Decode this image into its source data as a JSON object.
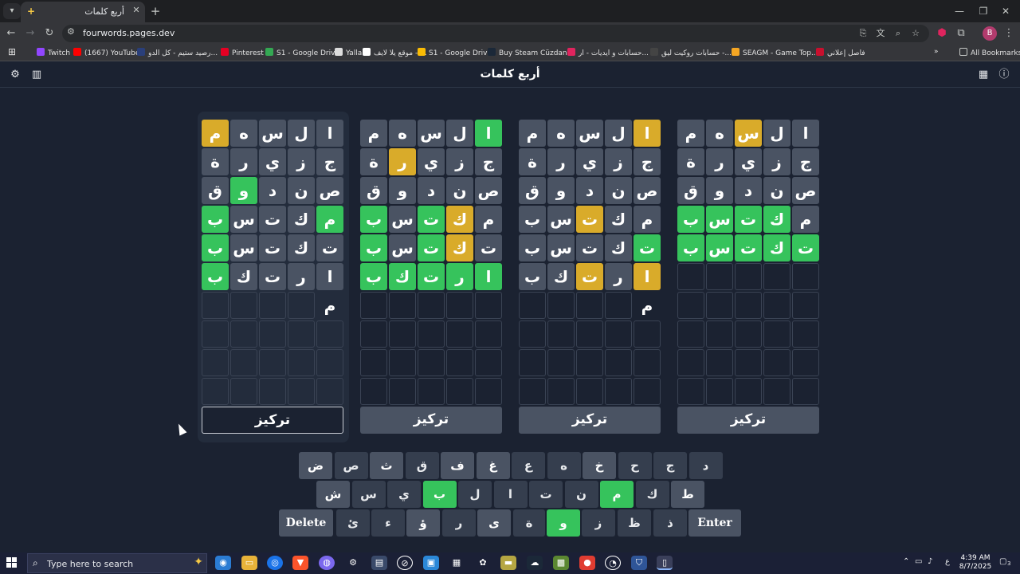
{
  "browser": {
    "tab_title": "أربع كلمات",
    "tab_favicon": "+",
    "tab_close": "✕",
    "new_tab": "+",
    "tab_menu": "▾",
    "window_controls": {
      "minimize": "—",
      "restore": "❐",
      "close": "✕"
    },
    "url": "fourwords.pages.dev",
    "profile_initial": "B"
  },
  "bookmarks": {
    "items": [
      {
        "label": "Twitch",
        "color": "#9146ff"
      },
      {
        "label": "(1667) YouTube",
        "color": "#ff0000"
      },
      {
        "label": "رصيد ستيم - كل الدو...",
        "color": "#2a3f7a"
      },
      {
        "label": "Pinterest",
        "color": "#e60023"
      },
      {
        "label": "S1 - Google Drive",
        "color": "#34a853"
      },
      {
        "label": "Yalla",
        "color": "#dddddd"
      },
      {
        "label": "موقع يلا لايف - ...",
        "color": "#ffffff"
      },
      {
        "label": "S1 - Google Drive",
        "color": "#fbbc04"
      },
      {
        "label": "Buy Steam Cüzdan...",
        "color": "#1b2838"
      },
      {
        "label": "حسابات و ايديات - ار...",
        "color": "#e0245e"
      },
      {
        "label": "حسابات روكيت ليق -...",
        "color": "#444444"
      },
      {
        "label": "SEAGM - Game Top...",
        "color": "#f5a623"
      },
      {
        "label": "فاصل إعلاني",
        "color": "#c8102e"
      }
    ],
    "more": "»",
    "all_bookmarks": "All Bookmarks"
  },
  "app": {
    "title": "أربع كلمات",
    "focus_label": "تركيز"
  },
  "boards": [
    {
      "rows": [
        [
          {
            "l": "م",
            "s": "y"
          },
          {
            "l": "ه",
            "s": "a"
          },
          {
            "l": "س",
            "s": "a"
          },
          {
            "l": "ل",
            "s": "a"
          },
          {
            "l": "ا",
            "s": "a"
          }
        ],
        [
          {
            "l": "ة",
            "s": "a"
          },
          {
            "l": "ر",
            "s": "a"
          },
          {
            "l": "ي",
            "s": "a"
          },
          {
            "l": "ز",
            "s": "a"
          },
          {
            "l": "ج",
            "s": "a"
          }
        ],
        [
          {
            "l": "ق",
            "s": "a"
          },
          {
            "l": "و",
            "s": "g"
          },
          {
            "l": "د",
            "s": "a"
          },
          {
            "l": "ن",
            "s": "a"
          },
          {
            "l": "ص",
            "s": "a"
          }
        ],
        [
          {
            "l": "ب",
            "s": "g"
          },
          {
            "l": "س",
            "s": "a"
          },
          {
            "l": "ت",
            "s": "a"
          },
          {
            "l": "ك",
            "s": "a"
          },
          {
            "l": "م",
            "s": "g"
          }
        ],
        [
          {
            "l": "ب",
            "s": "g"
          },
          {
            "l": "س",
            "s": "a"
          },
          {
            "l": "ت",
            "s": "a"
          },
          {
            "l": "ك",
            "s": "a"
          },
          {
            "l": "ت",
            "s": "a"
          }
        ],
        [
          {
            "l": "ب",
            "s": "g"
          },
          {
            "l": "ك",
            "s": "a"
          },
          {
            "l": "ت",
            "s": "a"
          },
          {
            "l": "ر",
            "s": "a"
          },
          {
            "l": "ا",
            "s": "a"
          }
        ],
        [
          {
            "l": "",
            "s": "e"
          },
          {
            "l": "",
            "s": "e"
          },
          {
            "l": "",
            "s": "e"
          },
          {
            "l": "",
            "s": "e"
          },
          {
            "l": "م",
            "s": "t"
          }
        ],
        [
          {
            "l": "",
            "s": "e"
          },
          {
            "l": "",
            "s": "e"
          },
          {
            "l": "",
            "s": "e"
          },
          {
            "l": "",
            "s": "e"
          },
          {
            "l": "",
            "s": "e"
          }
        ],
        [
          {
            "l": "",
            "s": "e"
          },
          {
            "l": "",
            "s": "e"
          },
          {
            "l": "",
            "s": "e"
          },
          {
            "l": "",
            "s": "e"
          },
          {
            "l": "",
            "s": "e"
          }
        ],
        [
          {
            "l": "",
            "s": "e"
          },
          {
            "l": "",
            "s": "e"
          },
          {
            "l": "",
            "s": "e"
          },
          {
            "l": "",
            "s": "e"
          },
          {
            "l": "",
            "s": "e"
          }
        ]
      ]
    },
    {
      "rows": [
        [
          {
            "l": "م",
            "s": "a"
          },
          {
            "l": "ه",
            "s": "a"
          },
          {
            "l": "س",
            "s": "a"
          },
          {
            "l": "ل",
            "s": "a"
          },
          {
            "l": "ا",
            "s": "g"
          }
        ],
        [
          {
            "l": "ة",
            "s": "a"
          },
          {
            "l": "ر",
            "s": "y"
          },
          {
            "l": "ي",
            "s": "a"
          },
          {
            "l": "ز",
            "s": "a"
          },
          {
            "l": "ج",
            "s": "a"
          }
        ],
        [
          {
            "l": "ق",
            "s": "a"
          },
          {
            "l": "و",
            "s": "a"
          },
          {
            "l": "د",
            "s": "a"
          },
          {
            "l": "ن",
            "s": "a"
          },
          {
            "l": "ص",
            "s": "a"
          }
        ],
        [
          {
            "l": "ب",
            "s": "g"
          },
          {
            "l": "س",
            "s": "a"
          },
          {
            "l": "ت",
            "s": "g"
          },
          {
            "l": "ك",
            "s": "y"
          },
          {
            "l": "م",
            "s": "a"
          }
        ],
        [
          {
            "l": "ب",
            "s": "g"
          },
          {
            "l": "س",
            "s": "a"
          },
          {
            "l": "ت",
            "s": "g"
          },
          {
            "l": "ك",
            "s": "y"
          },
          {
            "l": "ت",
            "s": "a"
          }
        ],
        [
          {
            "l": "ب",
            "s": "g"
          },
          {
            "l": "ك",
            "s": "g"
          },
          {
            "l": "ت",
            "s": "g"
          },
          {
            "l": "ر",
            "s": "g"
          },
          {
            "l": "ا",
            "s": "g"
          }
        ],
        [
          {
            "l": "",
            "s": "e"
          },
          {
            "l": "",
            "s": "e"
          },
          {
            "l": "",
            "s": "e"
          },
          {
            "l": "",
            "s": "e"
          },
          {
            "l": "",
            "s": "e"
          }
        ],
        [
          {
            "l": "",
            "s": "e"
          },
          {
            "l": "",
            "s": "e"
          },
          {
            "l": "",
            "s": "e"
          },
          {
            "l": "",
            "s": "e"
          },
          {
            "l": "",
            "s": "e"
          }
        ],
        [
          {
            "l": "",
            "s": "e"
          },
          {
            "l": "",
            "s": "e"
          },
          {
            "l": "",
            "s": "e"
          },
          {
            "l": "",
            "s": "e"
          },
          {
            "l": "",
            "s": "e"
          }
        ],
        [
          {
            "l": "",
            "s": "e"
          },
          {
            "l": "",
            "s": "e"
          },
          {
            "l": "",
            "s": "e"
          },
          {
            "l": "",
            "s": "e"
          },
          {
            "l": "",
            "s": "e"
          }
        ]
      ]
    },
    {
      "rows": [
        [
          {
            "l": "م",
            "s": "a"
          },
          {
            "l": "ه",
            "s": "a"
          },
          {
            "l": "س",
            "s": "a"
          },
          {
            "l": "ل",
            "s": "a"
          },
          {
            "l": "ا",
            "s": "y"
          }
        ],
        [
          {
            "l": "ة",
            "s": "a"
          },
          {
            "l": "ر",
            "s": "a"
          },
          {
            "l": "ي",
            "s": "a"
          },
          {
            "l": "ز",
            "s": "a"
          },
          {
            "l": "ج",
            "s": "a"
          }
        ],
        [
          {
            "l": "ق",
            "s": "a"
          },
          {
            "l": "و",
            "s": "a"
          },
          {
            "l": "د",
            "s": "a"
          },
          {
            "l": "ن",
            "s": "a"
          },
          {
            "l": "ص",
            "s": "a"
          }
        ],
        [
          {
            "l": "ب",
            "s": "a"
          },
          {
            "l": "س",
            "s": "a"
          },
          {
            "l": "ت",
            "s": "y"
          },
          {
            "l": "ك",
            "s": "a"
          },
          {
            "l": "م",
            "s": "a"
          }
        ],
        [
          {
            "l": "ب",
            "s": "a"
          },
          {
            "l": "س",
            "s": "a"
          },
          {
            "l": "ت",
            "s": "a"
          },
          {
            "l": "ك",
            "s": "a"
          },
          {
            "l": "ت",
            "s": "g"
          }
        ],
        [
          {
            "l": "ب",
            "s": "a"
          },
          {
            "l": "ك",
            "s": "a"
          },
          {
            "l": "ت",
            "s": "y"
          },
          {
            "l": "ر",
            "s": "a"
          },
          {
            "l": "ا",
            "s": "y"
          }
        ],
        [
          {
            "l": "",
            "s": "e"
          },
          {
            "l": "",
            "s": "e"
          },
          {
            "l": "",
            "s": "e"
          },
          {
            "l": "",
            "s": "e"
          },
          {
            "l": "م",
            "s": "t"
          }
        ],
        [
          {
            "l": "",
            "s": "e"
          },
          {
            "l": "",
            "s": "e"
          },
          {
            "l": "",
            "s": "e"
          },
          {
            "l": "",
            "s": "e"
          },
          {
            "l": "",
            "s": "e"
          }
        ],
        [
          {
            "l": "",
            "s": "e"
          },
          {
            "l": "",
            "s": "e"
          },
          {
            "l": "",
            "s": "e"
          },
          {
            "l": "",
            "s": "e"
          },
          {
            "l": "",
            "s": "e"
          }
        ],
        [
          {
            "l": "",
            "s": "e"
          },
          {
            "l": "",
            "s": "e"
          },
          {
            "l": "",
            "s": "e"
          },
          {
            "l": "",
            "s": "e"
          },
          {
            "l": "",
            "s": "e"
          }
        ]
      ]
    },
    {
      "rows": [
        [
          {
            "l": "م",
            "s": "a"
          },
          {
            "l": "ه",
            "s": "a"
          },
          {
            "l": "س",
            "s": "y"
          },
          {
            "l": "ل",
            "s": "a"
          },
          {
            "l": "ا",
            "s": "a"
          }
        ],
        [
          {
            "l": "ة",
            "s": "a"
          },
          {
            "l": "ر",
            "s": "a"
          },
          {
            "l": "ي",
            "s": "a"
          },
          {
            "l": "ز",
            "s": "a"
          },
          {
            "l": "ج",
            "s": "a"
          }
        ],
        [
          {
            "l": "ق",
            "s": "a"
          },
          {
            "l": "و",
            "s": "a"
          },
          {
            "l": "د",
            "s": "a"
          },
          {
            "l": "ن",
            "s": "a"
          },
          {
            "l": "ص",
            "s": "a"
          }
        ],
        [
          {
            "l": "ب",
            "s": "g"
          },
          {
            "l": "س",
            "s": "g"
          },
          {
            "l": "ت",
            "s": "g"
          },
          {
            "l": "ك",
            "s": "g"
          },
          {
            "l": "م",
            "s": "a"
          }
        ],
        [
          {
            "l": "ب",
            "s": "g"
          },
          {
            "l": "س",
            "s": "g"
          },
          {
            "l": "ت",
            "s": "g"
          },
          {
            "l": "ك",
            "s": "g"
          },
          {
            "l": "ت",
            "s": "g"
          }
        ],
        [
          {
            "l": "",
            "s": "e"
          },
          {
            "l": "",
            "s": "e"
          },
          {
            "l": "",
            "s": "e"
          },
          {
            "l": "",
            "s": "e"
          },
          {
            "l": "",
            "s": "e"
          }
        ],
        [
          {
            "l": "",
            "s": "e"
          },
          {
            "l": "",
            "s": "e"
          },
          {
            "l": "",
            "s": "e"
          },
          {
            "l": "",
            "s": "e"
          },
          {
            "l": "",
            "s": "e"
          }
        ],
        [
          {
            "l": "",
            "s": "e"
          },
          {
            "l": "",
            "s": "e"
          },
          {
            "l": "",
            "s": "e"
          },
          {
            "l": "",
            "s": "e"
          },
          {
            "l": "",
            "s": "e"
          }
        ],
        [
          {
            "l": "",
            "s": "e"
          },
          {
            "l": "",
            "s": "e"
          },
          {
            "l": "",
            "s": "e"
          },
          {
            "l": "",
            "s": "e"
          },
          {
            "l": "",
            "s": "e"
          }
        ],
        [
          {
            "l": "",
            "s": "e"
          },
          {
            "l": "",
            "s": "e"
          },
          {
            "l": "",
            "s": "e"
          },
          {
            "l": "",
            "s": "e"
          },
          {
            "l": "",
            "s": "e"
          }
        ]
      ]
    }
  ],
  "keyboard": {
    "row1": [
      {
        "k": "ض",
        "s": "a"
      },
      {
        "k": "ص",
        "s": "d"
      },
      {
        "k": "ث",
        "s": "a"
      },
      {
        "k": "ق",
        "s": "d"
      },
      {
        "k": "ف",
        "s": "a"
      },
      {
        "k": "غ",
        "s": "a"
      },
      {
        "k": "ع",
        "s": "d"
      },
      {
        "k": "ه",
        "s": "d"
      },
      {
        "k": "خ",
        "s": "a"
      },
      {
        "k": "ح",
        "s": "d"
      },
      {
        "k": "ج",
        "s": "d"
      },
      {
        "k": "د",
        "s": "d"
      }
    ],
    "row2": [
      {
        "k": "ش",
        "s": "a"
      },
      {
        "k": "س",
        "s": "d"
      },
      {
        "k": "ي",
        "s": "d"
      },
      {
        "k": "ب",
        "s": "g"
      },
      {
        "k": "ل",
        "s": "d"
      },
      {
        "k": "ا",
        "s": "d"
      },
      {
        "k": "ت",
        "s": "d"
      },
      {
        "k": "ن",
        "s": "d"
      },
      {
        "k": "م",
        "s": "g"
      },
      {
        "k": "ك",
        "s": "d"
      },
      {
        "k": "ط",
        "s": "a"
      }
    ],
    "row3": [
      {
        "k": "Delete",
        "s": "a"
      },
      {
        "k": "ئ",
        "s": "d"
      },
      {
        "k": "ء",
        "s": "d"
      },
      {
        "k": "ؤ",
        "s": "a"
      },
      {
        "k": "ر",
        "s": "d"
      },
      {
        "k": "ى",
        "s": "a"
      },
      {
        "k": "ة",
        "s": "d"
      },
      {
        "k": "و",
        "s": "g"
      },
      {
        "k": "ز",
        "s": "d"
      },
      {
        "k": "ظ",
        "s": "d"
      },
      {
        "k": "ذ",
        "s": "d"
      },
      {
        "k": "Enter",
        "s": "a"
      }
    ]
  },
  "taskbar": {
    "search_placeholder": "Type here to search",
    "lang": "ع",
    "time": "4:39 AM",
    "date": "8/7/2025",
    "notifications": "3"
  }
}
